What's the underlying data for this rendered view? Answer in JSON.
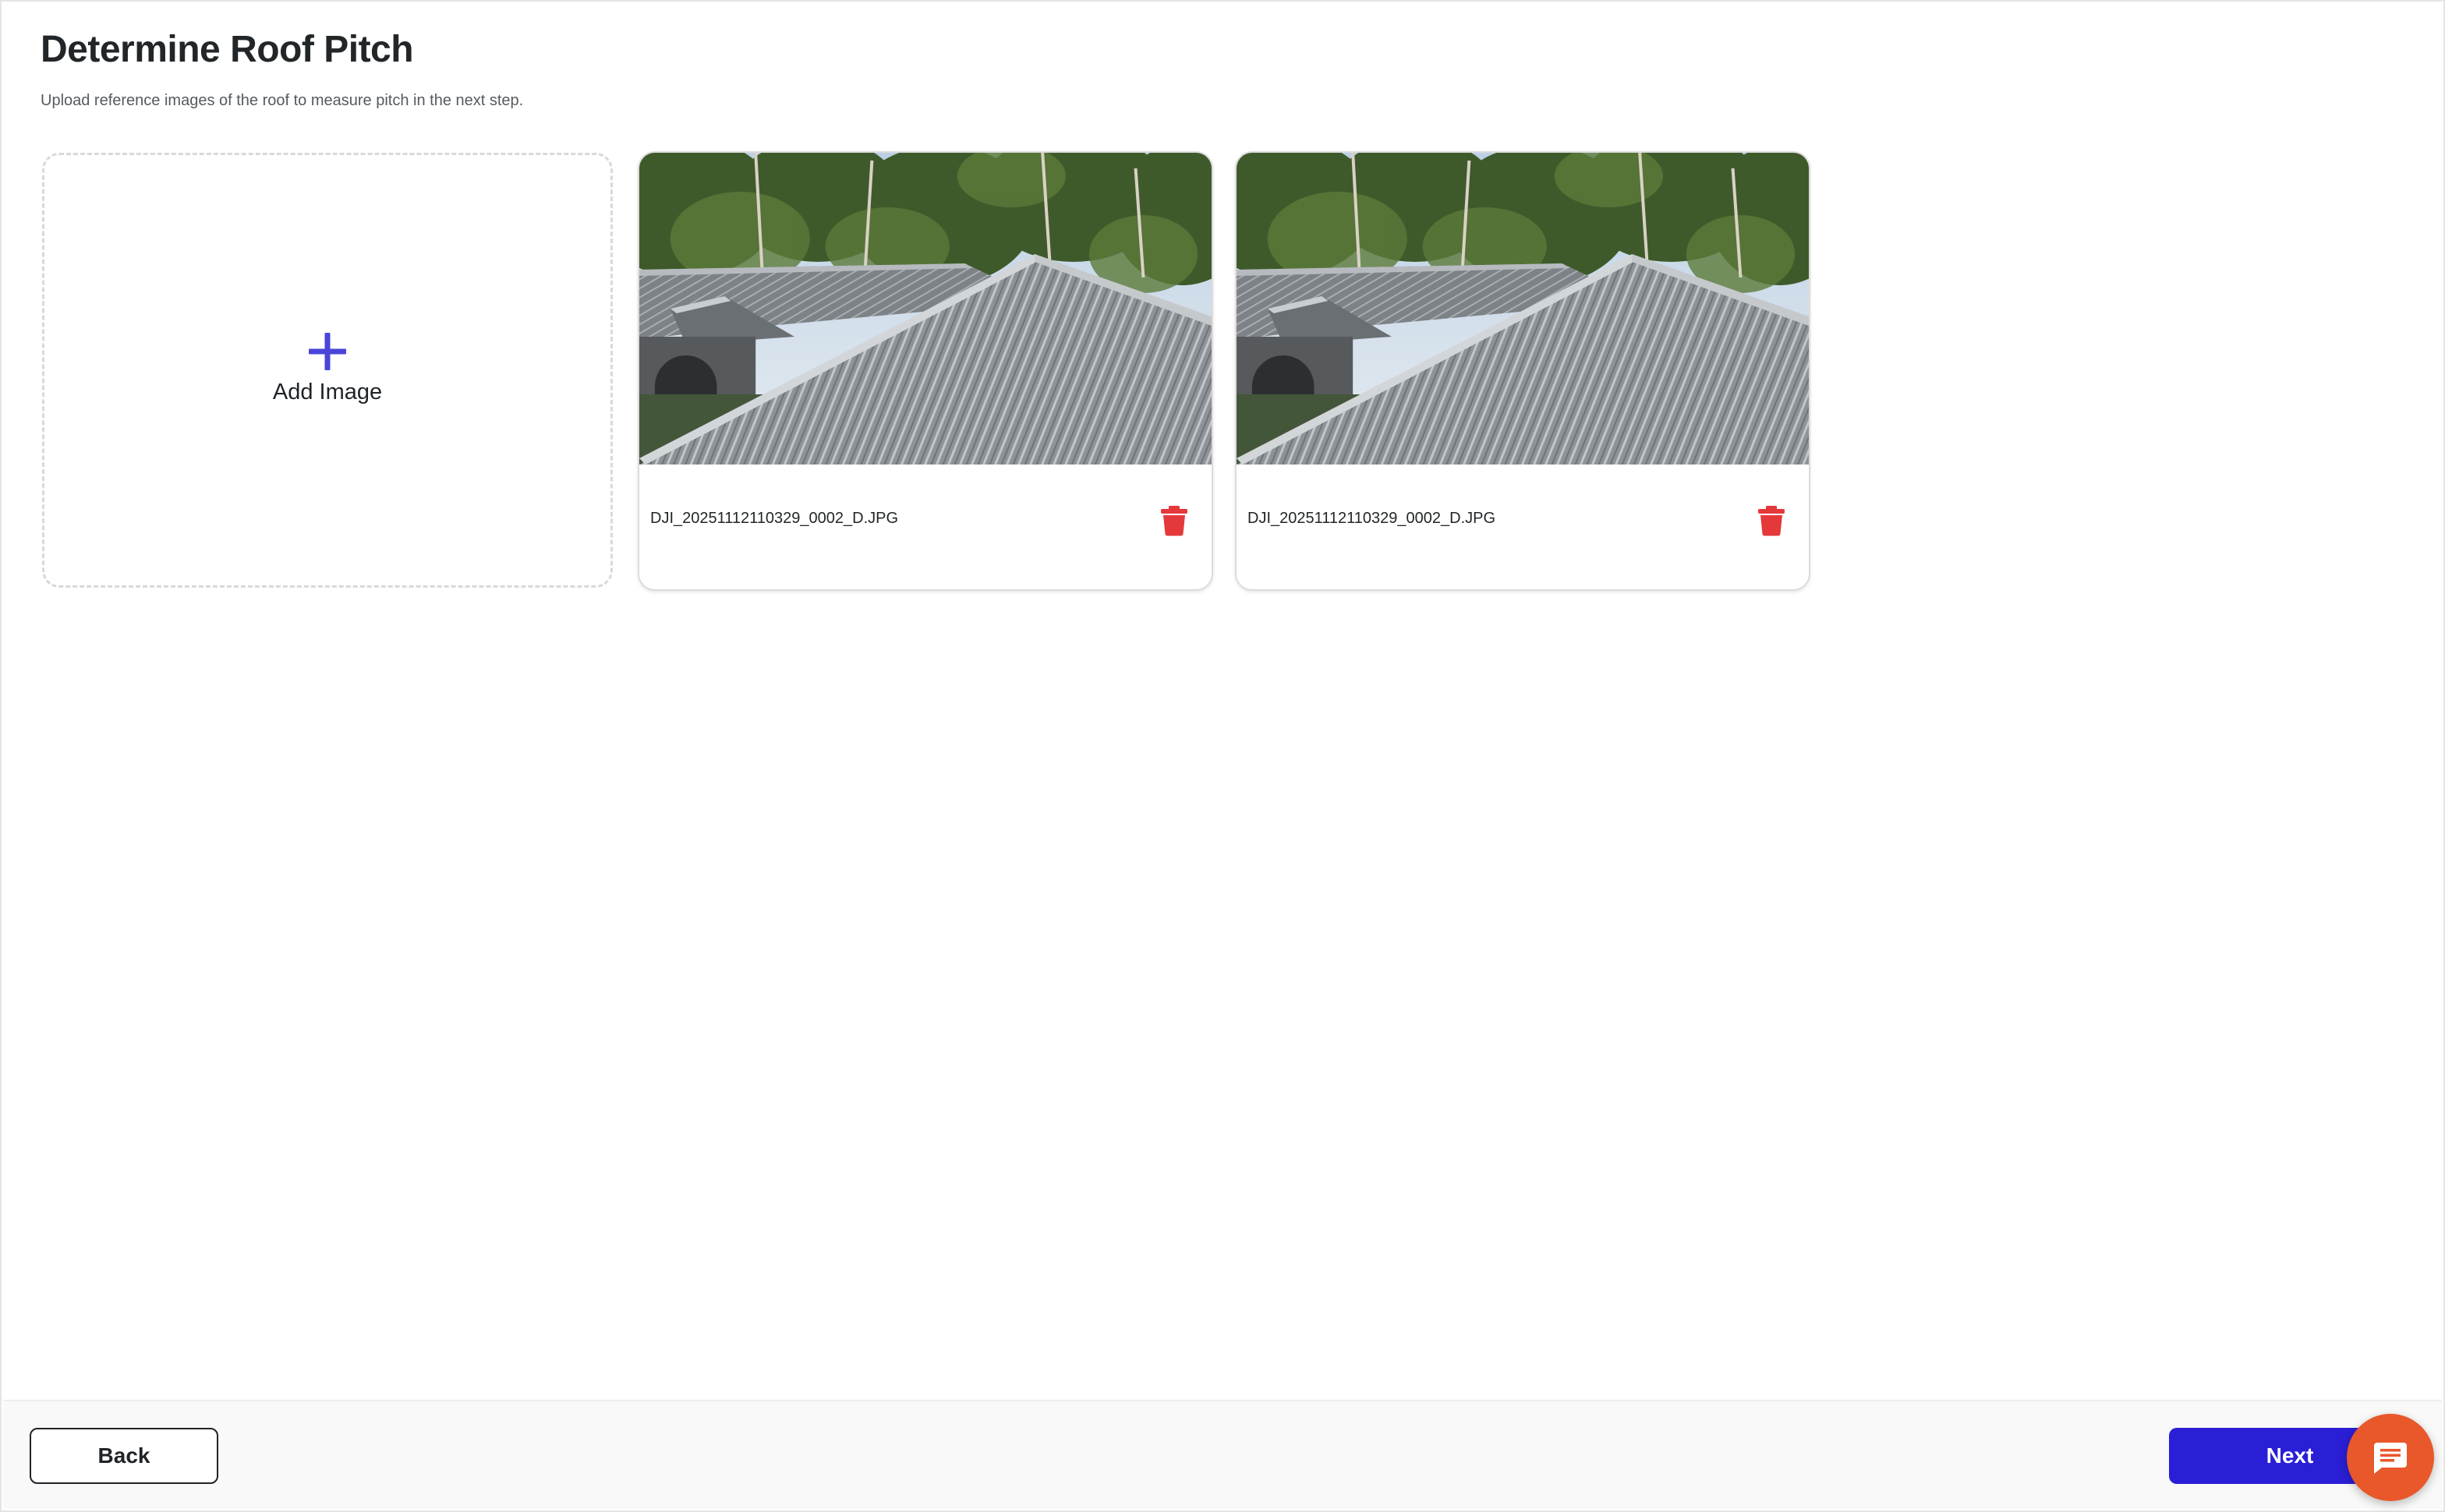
{
  "page": {
    "title": "Determine Roof Pitch",
    "subtitle": "Upload reference images of the roof to measure pitch in the next step."
  },
  "add_card": {
    "label": "Add Image",
    "icon": "plus-icon"
  },
  "images": [
    {
      "file_name": "DJI_20251112110329_0002_D.JPG",
      "delete_icon": "trash-icon"
    },
    {
      "file_name": "DJI_20251112110329_0002_D.JPG",
      "delete_icon": "trash-icon"
    }
  ],
  "footer": {
    "back_label": "Back",
    "next_label": "Next"
  },
  "chat": {
    "icon": "chat-bubble-icon"
  },
  "colors": {
    "accent": "#2a1fd6",
    "plus": "#4a44d8",
    "danger": "#e5383b",
    "chat": "#e8582a"
  }
}
